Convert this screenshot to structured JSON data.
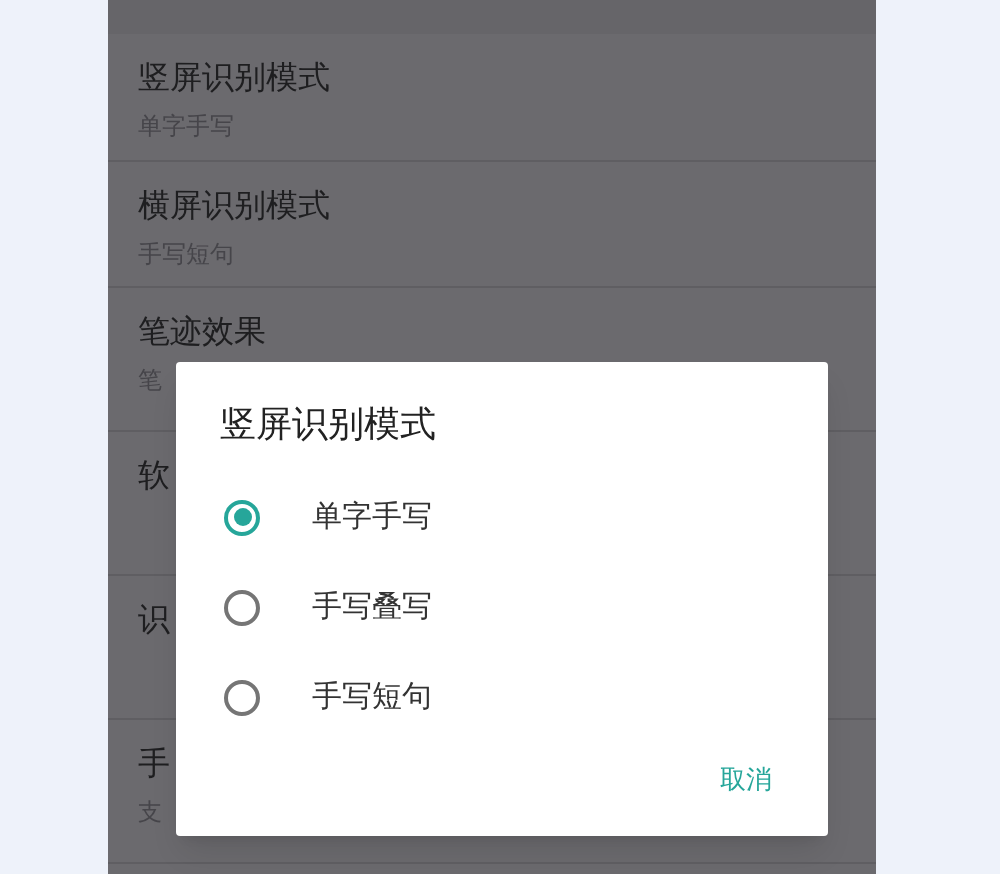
{
  "settings": [
    {
      "title": "竖屏识别模式",
      "subtitle": "单字手写"
    },
    {
      "title": "横屏识别模式",
      "subtitle": "手写短句"
    },
    {
      "title": "笔迹效果",
      "subtitle": "笔"
    },
    {
      "title": "软"
    },
    {
      "title": "识"
    },
    {
      "title": "手",
      "subtitle": "支"
    }
  ],
  "dialog": {
    "title": "竖屏识别模式",
    "options": [
      {
        "label": "单字手写",
        "selected": true
      },
      {
        "label": "手写叠写",
        "selected": false
      },
      {
        "label": "手写短句",
        "selected": false
      }
    ],
    "buttons": [
      "取消"
    ]
  }
}
